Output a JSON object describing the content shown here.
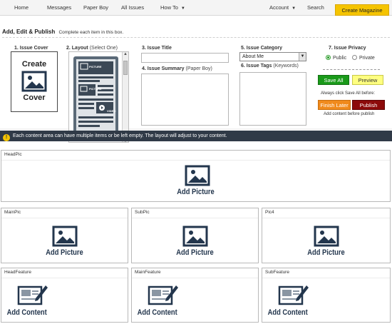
{
  "nav": {
    "home": "Home",
    "messages": "Messages",
    "paper_boy": "Paper Boy",
    "all_issues": "All Issues",
    "how_to": "How To",
    "account": "Account",
    "search": "Search",
    "create_magazine": "Create Magazine"
  },
  "panel": {
    "title": "Add, Edit & Publish",
    "subtitle": "Complete each item in this box.",
    "steps": {
      "cover": "1. Issue Cover",
      "layout": "2. Layout",
      "layout_hint": "(Select One)",
      "title": "3. Issue Title",
      "summary": "4. Issue Summary",
      "summary_hint": "(Paper Boy)",
      "category": "5. Issue Category",
      "tags": "6. Issue Tags",
      "tags_hint": "(Keywords)",
      "privacy": "7. Issue Privacy"
    },
    "cover_box": {
      "top": "Create",
      "bottom": "Cover"
    },
    "layout_thumb": {
      "picture1": "PICTURE",
      "picture2": "PICTURE",
      "video": "VIDEO"
    },
    "category_value": "About Me",
    "privacy": {
      "public": "Public",
      "private": "Private",
      "selected": "Public"
    },
    "buttons": {
      "save_all": "Save All",
      "preview": "Preview",
      "finish_later": "Finish Later",
      "publish": "Publish"
    },
    "notes": {
      "save_first": "Always click Save All before:",
      "add_content": "Add content before publish"
    },
    "swatch_colors": [
      "#222222",
      "#1f3f8f",
      "#1a8f2a",
      "#c8c100",
      "#e07a00",
      "#c21d1d",
      "#7a1f8f",
      "#3a7fbf",
      "#8c5a2b",
      "#9a9a9a",
      "#dcdcdc"
    ]
  },
  "infobar": {
    "text": "Each content area can have multiple items or be left empty. The layout will adjust to your content."
  },
  "slots": {
    "headpic": {
      "name": "HeadPic",
      "action": "Add Picture"
    },
    "mainpic": {
      "name": "MainPic",
      "action": "Add Picture"
    },
    "subpic": {
      "name": "SubPic",
      "action": "Add Picture"
    },
    "pic4": {
      "name": "Pic4",
      "action": "Add Picture"
    },
    "headfeature": {
      "name": "HeadFeature",
      "action": "Add Content"
    },
    "mainfeature": {
      "name": "MainFeature",
      "action": "Add Content"
    },
    "subfeature": {
      "name": "SubFeature",
      "action": "Add Content"
    }
  },
  "colors": {
    "accent_yellow": "#f5c400",
    "save_green": "#1a9a1a",
    "preview_yellow": "#ffff80",
    "finish_orange": "#f08a1c",
    "publish_red": "#8c0a0a",
    "infobar_bg": "#303a47",
    "icon_navy": "#23364d"
  }
}
